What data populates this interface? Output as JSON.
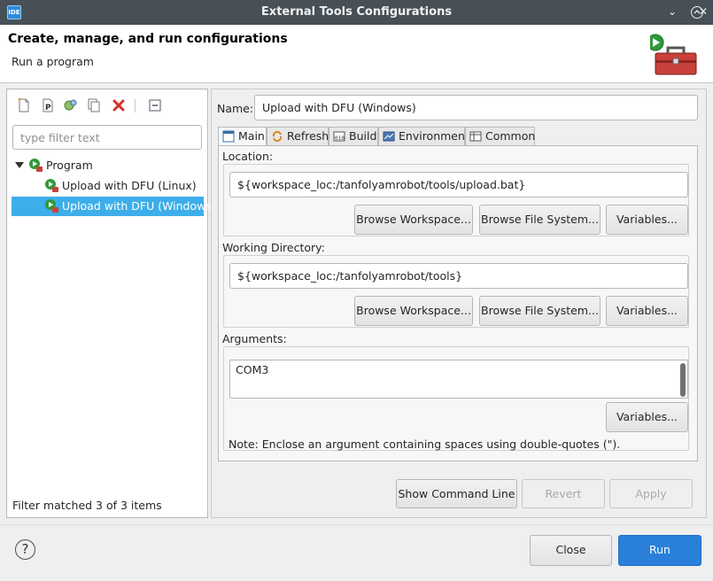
{
  "window": {
    "title": "External Tools Configurations",
    "app_icon_text": "IDE",
    "restore_glyph": "⌄",
    "close_glyph": "✕"
  },
  "header": {
    "title": "Create, manage, and run configurations",
    "subtitle": "Run a program"
  },
  "left": {
    "filter_placeholder": "type filter text",
    "tree": [
      {
        "label": "Program",
        "level": 0,
        "expanded": true,
        "selected": false
      },
      {
        "label": "Upload with DFU (Linux)",
        "level": 1,
        "selected": false
      },
      {
        "label": "Upload with DFU (Windows)",
        "level": 1,
        "selected": true
      }
    ],
    "status": "Filter matched 3 of 3 items"
  },
  "right": {
    "name_label": "Name:",
    "name_value": "Upload with DFU (Windows)",
    "tabs": [
      {
        "label": "Main",
        "icon": "main-tab-icon",
        "active": true
      },
      {
        "label": "Refresh",
        "icon": "refresh-icon",
        "active": false
      },
      {
        "label": "Build",
        "icon": "build-icon",
        "active": false
      },
      {
        "label": "Environment",
        "icon": "environment-icon",
        "active": false
      },
      {
        "label": "Common",
        "icon": "common-icon",
        "active": false
      }
    ],
    "location": {
      "label": "Location:",
      "value": "${workspace_loc:/tanfolyamrobot/tools/upload.bat}",
      "browse_workspace": "Browse Workspace...",
      "browse_file_system": "Browse File System...",
      "variables": "Variables..."
    },
    "working_directory": {
      "label": "Working Directory:",
      "value": "${workspace_loc:/tanfolyamrobot/tools}",
      "browse_workspace": "Browse Workspace...",
      "browse_file_system": "Browse File System...",
      "variables": "Variables..."
    },
    "arguments": {
      "label": "Arguments:",
      "value": "COM3",
      "variables": "Variables...",
      "note": "Note: Enclose an argument containing spaces using double-quotes (\")."
    },
    "actions": {
      "show_command_line": "Show Command Line",
      "revert": "Revert",
      "apply": "Apply"
    }
  },
  "footer": {
    "help": "?",
    "close": "Close",
    "run": "Run"
  },
  "colors": {
    "accent": "#3daee9",
    "primary_button": "#2a7fd9",
    "titlebar": "#475057"
  }
}
